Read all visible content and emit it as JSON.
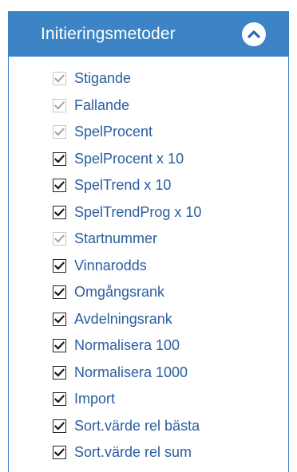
{
  "panel": {
    "title": "Initieringsmetoder",
    "collapse_icon": "chevron-up-icon"
  },
  "colors": {
    "header_bg": "#3d84c6",
    "label_text": "#2a5da0",
    "check_enabled": "#1a1a1a",
    "check_disabled": "#a9a9a9"
  },
  "items": [
    {
      "label": "Stigande",
      "checked": true,
      "enabled": false
    },
    {
      "label": "Fallande",
      "checked": true,
      "enabled": false
    },
    {
      "label": "SpelProcent",
      "checked": true,
      "enabled": false
    },
    {
      "label": "SpelProcent x 10",
      "checked": true,
      "enabled": true
    },
    {
      "label": "SpelTrend x 10",
      "checked": true,
      "enabled": true
    },
    {
      "label": "SpelTrendProg x 10",
      "checked": true,
      "enabled": true
    },
    {
      "label": "Startnummer",
      "checked": true,
      "enabled": false
    },
    {
      "label": "Vinnarodds",
      "checked": true,
      "enabled": true
    },
    {
      "label": "Omgångsrank",
      "checked": true,
      "enabled": true
    },
    {
      "label": "Avdelningsrank",
      "checked": true,
      "enabled": true
    },
    {
      "label": "Normalisera 100",
      "checked": true,
      "enabled": true
    },
    {
      "label": "Normalisera 1000",
      "checked": true,
      "enabled": true
    },
    {
      "label": "Import",
      "checked": true,
      "enabled": true
    },
    {
      "label": "Sort.värde rel bästa",
      "checked": true,
      "enabled": true
    },
    {
      "label": "Sort.värde rel sum",
      "checked": true,
      "enabled": true
    }
  ]
}
